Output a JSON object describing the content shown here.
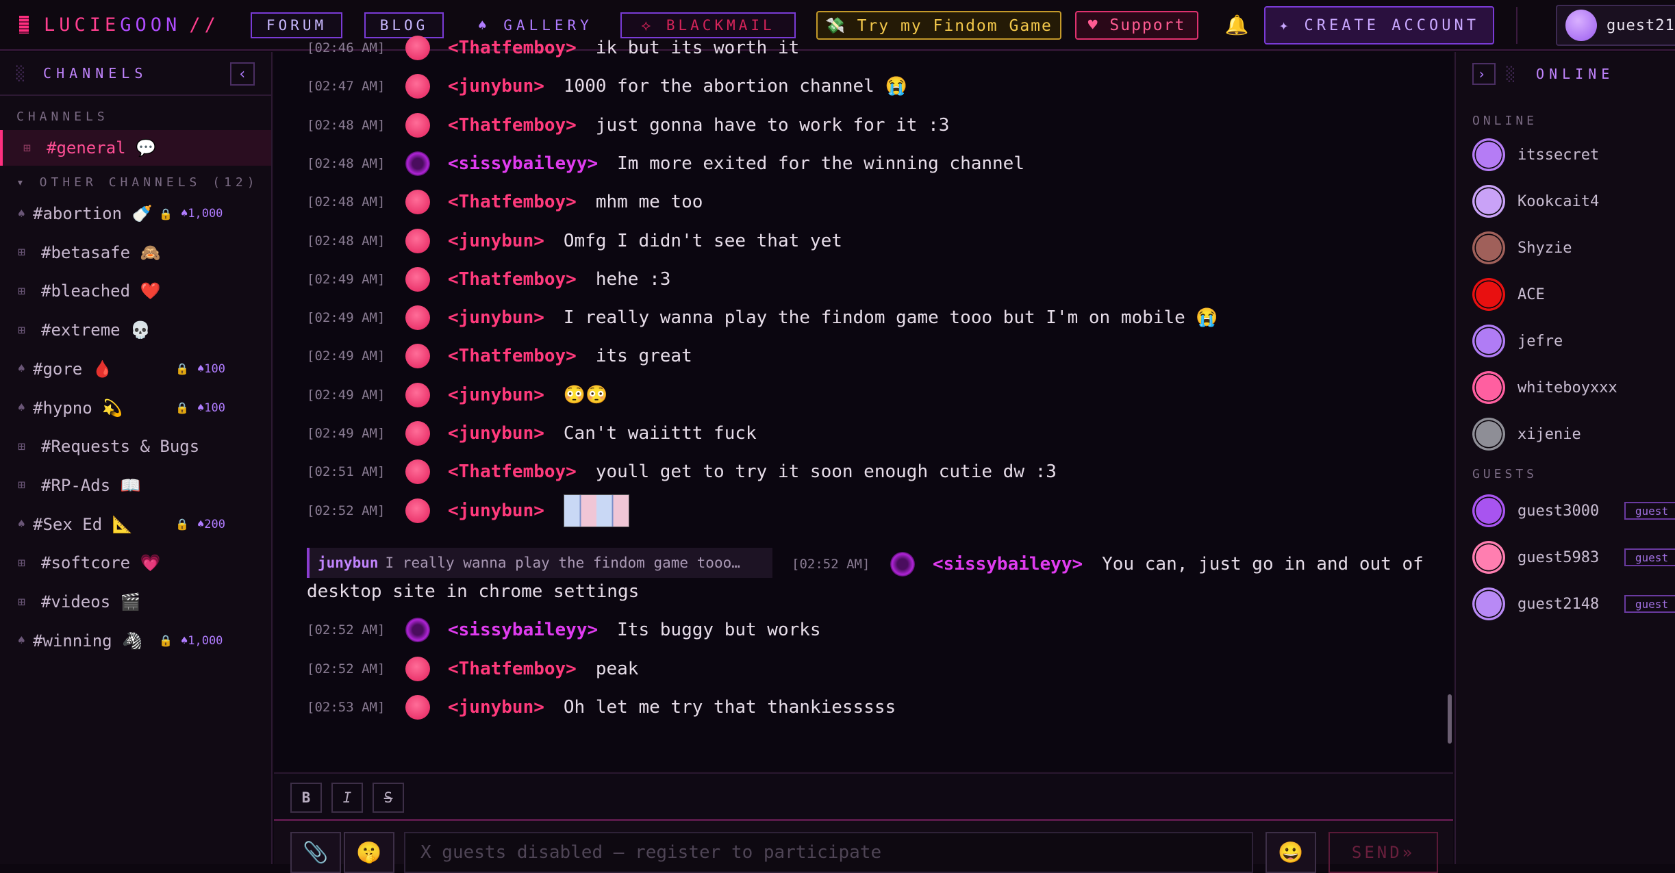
{
  "header": {
    "logo_main": "LUCIE",
    "logo_accent": "GOON",
    "logo_slash": "//",
    "nav": [
      {
        "label": "FORUM"
      },
      {
        "label": "BLOG"
      }
    ],
    "gallery_label": "♠ GALLERY",
    "blackmail_label": "⟡ BLACKMAIL",
    "findom_label": "💸 Try my Findom Game",
    "support_label": "♥ Support",
    "create_label": "✦ CREATE ACCOUNT",
    "user_name": "guest21",
    "bell_icon": "🔔"
  },
  "sidebar": {
    "title": "CHANNELS",
    "collapse_label": "‹",
    "section_channels": "CHANNELS",
    "section_other": "▾ OTHER CHANNELS (12)",
    "active_channel": {
      "prefix": "⊞",
      "name": "#general 💬"
    },
    "channels": [
      {
        "prefix": "♠",
        "name": "#abortion 🍼",
        "locked": true,
        "cost": "♠1,000"
      },
      {
        "prefix": "⊞",
        "name": "#betasafe 🙈",
        "locked": false,
        "cost": ""
      },
      {
        "prefix": "⊞",
        "name": "#bleached ❤️",
        "locked": false,
        "cost": ""
      },
      {
        "prefix": "⊞",
        "name": "#extreme 💀",
        "locked": false,
        "cost": ""
      },
      {
        "prefix": "♠",
        "name": "#gore 🩸",
        "locked": true,
        "cost": "♠100"
      },
      {
        "prefix": "♠",
        "name": "#hypno 💫",
        "locked": true,
        "cost": "♠100"
      },
      {
        "prefix": "⊞",
        "name": "#Requests & Bugs",
        "locked": false,
        "cost": ""
      },
      {
        "prefix": "⊞",
        "name": "#RP-Ads 📖",
        "locked": false,
        "cost": ""
      },
      {
        "prefix": "♠",
        "name": "#Sex Ed 📐",
        "locked": true,
        "cost": "♠200"
      },
      {
        "prefix": "⊞",
        "name": "#softcore 💗",
        "locked": false,
        "cost": ""
      },
      {
        "prefix": "⊞",
        "name": "#videos 🎬",
        "locked": false,
        "cost": ""
      },
      {
        "prefix": "♠",
        "name": "#winning 🦓",
        "locked": true,
        "cost": "♠1,000"
      }
    ],
    "lock_icon": "🔒"
  },
  "messages": [
    {
      "time": "[02:46 AM]",
      "nick": "<Thatfemboy>",
      "text": "ik but its worth it",
      "sissy": false
    },
    {
      "time": "[02:47 AM]",
      "nick": "<junybun>",
      "text": "1000 for the abortion channel 😭",
      "sissy": false
    },
    {
      "time": "[02:48 AM]",
      "nick": "<Thatfemboy>",
      "text": "just gonna have to work for it :3",
      "sissy": false
    },
    {
      "time": "[02:48 AM]",
      "nick": "<sissybaileyy>",
      "text": "Im more exited for the winning channel",
      "sissy": true
    },
    {
      "time": "[02:48 AM]",
      "nick": "<Thatfemboy>",
      "text": "mhm me too",
      "sissy": false
    },
    {
      "time": "[02:48 AM]",
      "nick": "<junybun>",
      "text": "Omfg I didn't see that yet",
      "sissy": false
    },
    {
      "time": "[02:49 AM]",
      "nick": "<Thatfemboy>",
      "text": "hehe :3",
      "sissy": false
    },
    {
      "time": "[02:49 AM]",
      "nick": "<junybun>",
      "text": "I really wanna play the findom game tooo but I'm on mobile 😭",
      "sissy": false
    },
    {
      "time": "[02:49 AM]",
      "nick": "<Thatfemboy>",
      "text": "its great",
      "sissy": false
    },
    {
      "time": "[02:49 AM]",
      "nick": "<junybun>",
      "text": "😳😳",
      "sissy": false
    },
    {
      "time": "[02:49 AM]",
      "nick": "<junybun>",
      "text": "Can't waiittt fuck",
      "sissy": false
    },
    {
      "time": "[02:51 AM]",
      "nick": "<Thatfemboy>",
      "text": "youll get to try it soon enough cutie dw :3",
      "sissy": false
    },
    {
      "time": "[02:52 AM]",
      "nick": "<junybun>",
      "text": "",
      "sissy": false,
      "image": true
    }
  ],
  "reply_message": {
    "quote_author": "junybun",
    "quote_text": "I really wanna play the findom game tooo…",
    "time": "[02:52 AM]",
    "nick": "<sissybaileyy>",
    "text_line1": "You can, just go in and out of",
    "text_line2": "desktop site in chrome settings"
  },
  "messages_after": [
    {
      "time": "[02:52 AM]",
      "nick": "<sissybaileyy>",
      "text": "Its buggy but works",
      "sissy": true
    },
    {
      "time": "[02:52 AM]",
      "nick": "<Thatfemboy>",
      "text": "peak",
      "sissy": false
    },
    {
      "time": "[02:53 AM]",
      "nick": "<junybun>",
      "text": "Oh let me try that thankiesssss",
      "sissy": false
    }
  ],
  "format_bar": {
    "bold": "B",
    "italic": "I",
    "strike": "S"
  },
  "composer": {
    "attach_icon": "📎",
    "emoji_small_icon": "🤫",
    "placeholder": "X guests disabled — register to participate",
    "emoji_icon": "😀",
    "send_label": "SEND»"
  },
  "online_panel": {
    "title": "ONLINE",
    "collapse_label": "›",
    "section_online": "ONLINE",
    "section_guests": "GUESTS",
    "online": [
      {
        "name": "itssecret",
        "color": "#b57cf5"
      },
      {
        "name": "Kookcait4",
        "color": "#c9a2f7"
      },
      {
        "name": "Shyzie",
        "color": "#a0605a"
      },
      {
        "name": "ACE",
        "color": "#e81010"
      },
      {
        "name": "jefre",
        "color": "#b07cf5"
      },
      {
        "name": "whiteboyxxx",
        "color": "#ff5fa0"
      },
      {
        "name": "xijenie",
        "color": "#8e8e96"
      }
    ],
    "guests": [
      {
        "name": "guest3000",
        "tag": "guest",
        "color": "#a854f0"
      },
      {
        "name": "guest5983",
        "tag": "guest",
        "color": "#ff7eb0"
      },
      {
        "name": "guest2148",
        "tag": "guest",
        "color": "#b889f5"
      }
    ]
  }
}
